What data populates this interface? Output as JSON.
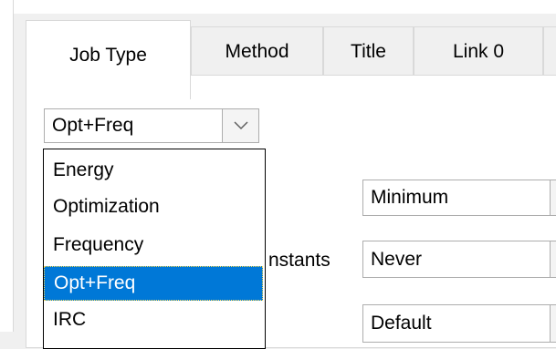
{
  "tabs": [
    {
      "label": "Job Type",
      "active": true
    },
    {
      "label": "Method",
      "active": false
    },
    {
      "label": "Title",
      "active": false
    },
    {
      "label": "Link 0",
      "active": false
    }
  ],
  "job_type_combo": {
    "value": "Opt+Freq",
    "options": [
      "Energy",
      "Optimization",
      "Frequency",
      "Opt+Freq",
      "IRC"
    ],
    "selected": "Opt+Freq"
  },
  "partial_label": "nstants",
  "right_combos": {
    "first": "Minimum",
    "second": "Never",
    "third": "Default"
  },
  "colors": {
    "selection": "#0078d7",
    "panel": "#ffffff",
    "window": "#f0f0f0"
  },
  "icons": {
    "combo_arrow": "chevron-down-icon"
  }
}
